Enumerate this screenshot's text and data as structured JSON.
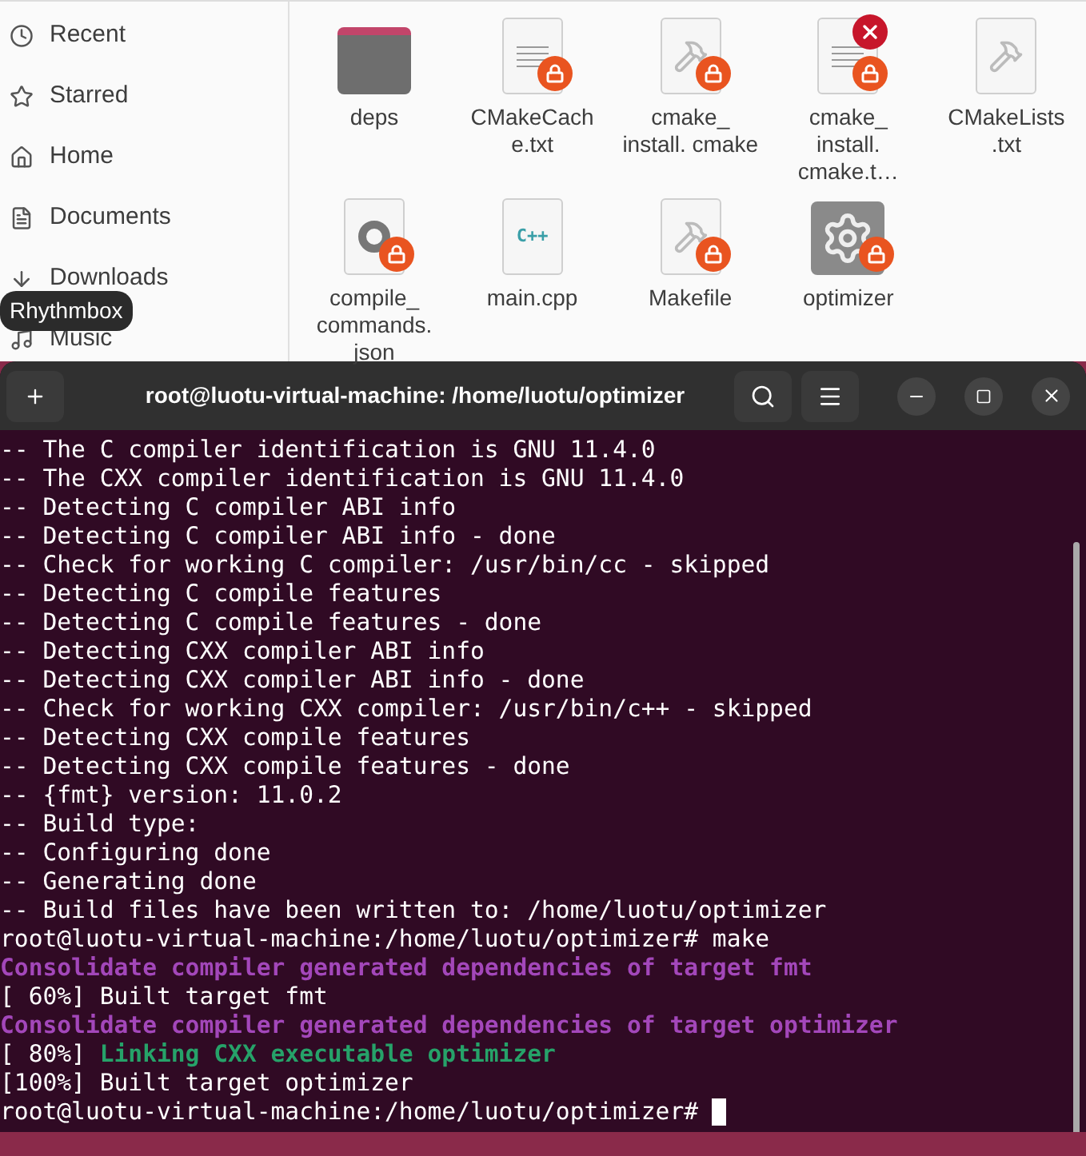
{
  "sidebar": {
    "items": [
      {
        "label": "Recent"
      },
      {
        "label": "Starred"
      },
      {
        "label": "Home"
      },
      {
        "label": "Documents"
      },
      {
        "label": "Downloads"
      },
      {
        "label": "Music"
      }
    ]
  },
  "tooltip": {
    "text": "Rhythmbox"
  },
  "files": [
    {
      "name": "deps",
      "kind": "folder",
      "locked": false,
      "error": false
    },
    {
      "name": "CMakeCach e.txt",
      "kind": "text",
      "locked": true,
      "error": false
    },
    {
      "name": "cmake_ install. cmake",
      "kind": "script",
      "locked": true,
      "error": false
    },
    {
      "name": "cmake_ install. cmake.t…",
      "kind": "text",
      "locked": true,
      "error": true
    },
    {
      "name": "CMakeLists .txt",
      "kind": "script",
      "locked": false,
      "error": false
    },
    {
      "name": "compile_ commands. json",
      "kind": "json",
      "locked": true,
      "error": false
    },
    {
      "name": "main.cpp",
      "kind": "cpp",
      "locked": false,
      "error": false,
      "glyph": "C++"
    },
    {
      "name": "Makefile",
      "kind": "script",
      "locked": true,
      "error": false
    },
    {
      "name": "optimizer",
      "kind": "executable",
      "locked": true,
      "error": false
    }
  ],
  "terminal": {
    "title": "root@luotu-virtual-machine: /home/luotu/optimizer",
    "lines": [
      [
        {
          "kind": "plain",
          "text": "-- The C compiler identification is GNU 11.4.0"
        }
      ],
      [
        {
          "kind": "plain",
          "text": "-- The CXX compiler identification is GNU 11.4.0"
        }
      ],
      [
        {
          "kind": "plain",
          "text": "-- Detecting C compiler ABI info"
        }
      ],
      [
        {
          "kind": "plain",
          "text": "-- Detecting C compiler ABI info - done"
        }
      ],
      [
        {
          "kind": "plain",
          "text": "-- Check for working C compiler: /usr/bin/cc - skipped"
        }
      ],
      [
        {
          "kind": "plain",
          "text": "-- Detecting C compile features"
        }
      ],
      [
        {
          "kind": "plain",
          "text": "-- Detecting C compile features - done"
        }
      ],
      [
        {
          "kind": "plain",
          "text": "-- Detecting CXX compiler ABI info"
        }
      ],
      [
        {
          "kind": "plain",
          "text": "-- Detecting CXX compiler ABI info - done"
        }
      ],
      [
        {
          "kind": "plain",
          "text": "-- Check for working CXX compiler: /usr/bin/c++ - skipped"
        }
      ],
      [
        {
          "kind": "plain",
          "text": "-- Detecting CXX compile features"
        }
      ],
      [
        {
          "kind": "plain",
          "text": "-- Detecting CXX compile features - done"
        }
      ],
      [
        {
          "kind": "plain",
          "text": "-- {fmt} version: 11.0.2"
        }
      ],
      [
        {
          "kind": "plain",
          "text": "-- Build type: "
        }
      ],
      [
        {
          "kind": "plain",
          "text": "-- Configuring done"
        }
      ],
      [
        {
          "kind": "plain",
          "text": "-- Generating done"
        }
      ],
      [
        {
          "kind": "plain",
          "text": "-- Build files have been written to: /home/luotu/optimizer"
        }
      ],
      [
        {
          "kind": "plain",
          "text": "root@luotu-virtual-machine:/home/luotu/optimizer# make"
        }
      ],
      [
        {
          "kind": "info",
          "text": "Consolidate compiler generated dependencies of target fmt"
        }
      ],
      [
        {
          "kind": "plain",
          "text": "[ 60%] Built target fmt"
        }
      ],
      [
        {
          "kind": "info",
          "text": "Consolidate compiler generated dependencies of target optimizer"
        }
      ],
      [
        {
          "kind": "plain",
          "text": "[ 80%] "
        },
        {
          "kind": "success",
          "text": "Linking CXX executable optimizer"
        }
      ],
      [
        {
          "kind": "plain",
          "text": "[100%] Built target optimizer"
        }
      ],
      [
        {
          "kind": "plain",
          "text": "root@luotu-virtual-machine:/home/luotu/optimizer# "
        },
        {
          "kind": "cursor"
        }
      ]
    ]
  }
}
